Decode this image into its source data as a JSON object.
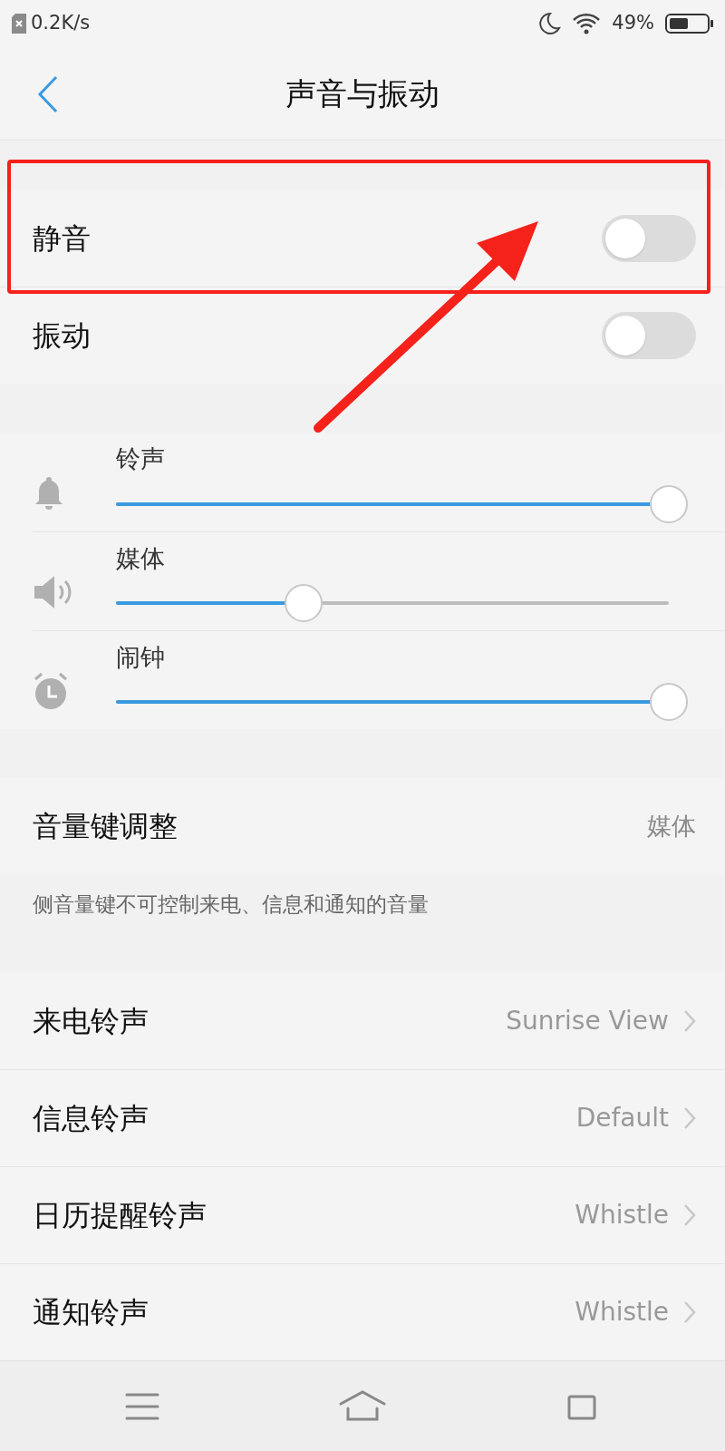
{
  "status_bar": {
    "speed": "0.2K/s",
    "battery_text": "49%"
  },
  "header": {
    "title": "声音与振动"
  },
  "switches": [
    {
      "label": "静音",
      "on": false
    },
    {
      "label": "振动",
      "on": false
    }
  ],
  "volumes": [
    {
      "kind": "bell",
      "label": "铃声",
      "level": 1
    },
    {
      "kind": "speaker",
      "label": "媒体",
      "level": 0.34
    },
    {
      "kind": "alarm",
      "label": "闹钟",
      "level": 1
    }
  ],
  "volume_key": {
    "label": "音量键调整",
    "value": "媒体",
    "note": "侧音量键不可控制来电、信息和通知的音量"
  },
  "ringtones": [
    {
      "label": "来电铃声",
      "value": "Sunrise View"
    },
    {
      "label": "信息铃声",
      "value": "Default"
    },
    {
      "label": "日历提醒铃声",
      "value": "Whistle"
    },
    {
      "label": "通知铃声",
      "value": "Whistle"
    }
  ]
}
